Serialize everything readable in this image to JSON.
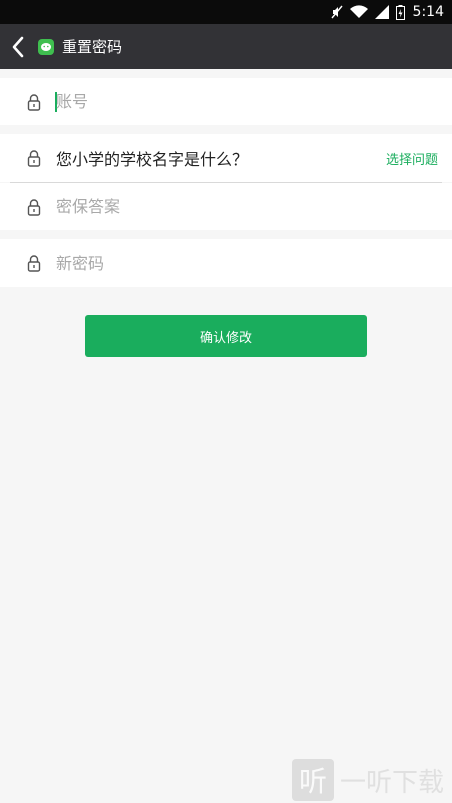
{
  "status_bar": {
    "time": "5:14",
    "icons": [
      "mute-icon",
      "wifi-icon",
      "signal-icon",
      "battery-icon"
    ]
  },
  "header": {
    "title": "重置密码",
    "back_icon": "chevron-left-icon",
    "app_icon": "wechat-logo-icon"
  },
  "form": {
    "account": {
      "placeholder": "账号",
      "value": ""
    },
    "security_question": {
      "text": "您小学的学校名字是什么？",
      "choose_label": "选择问题"
    },
    "security_answer": {
      "placeholder": "密保答案",
      "value": ""
    },
    "new_password": {
      "placeholder": "新密码",
      "value": ""
    },
    "confirm_label": "确认修改"
  },
  "watermark": {
    "glyph": "听",
    "text": "一听下载"
  },
  "colors": {
    "accent": "#1aad5d",
    "title_bar": "#323236",
    "status_bar": "#0b0b0b",
    "page_bg": "#f6f6f6"
  }
}
